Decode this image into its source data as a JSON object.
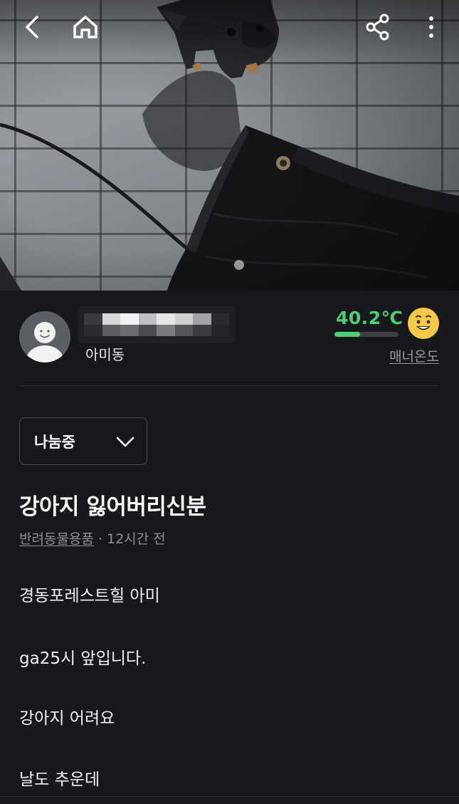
{
  "header": {
    "back_icon": "chevron-left-icon",
    "home_icon": "home-icon",
    "share_icon": "share-icon",
    "more_icon": "more-vertical-icon"
  },
  "hero": {
    "photo": "dog on paved sidewalk next to black jacket",
    "active_index": 1,
    "total_images": 1
  },
  "seller": {
    "location": "아미동",
    "manner_temp": "40.2℃",
    "manner_temp_value": 40.2,
    "manner_fill_fraction": 0.4,
    "manner_label": "매너온도",
    "temp_color": "#4ccf73"
  },
  "post": {
    "status": "나눔중",
    "title": "강아지 잃어버리신분",
    "category": "반려동물용품",
    "time": " · 12시간 전",
    "body": [
      "경동포레스트힐 아미",
      "ga25시 앞입니다.",
      "강아지 어려요",
      "날도 추운데"
    ]
  }
}
